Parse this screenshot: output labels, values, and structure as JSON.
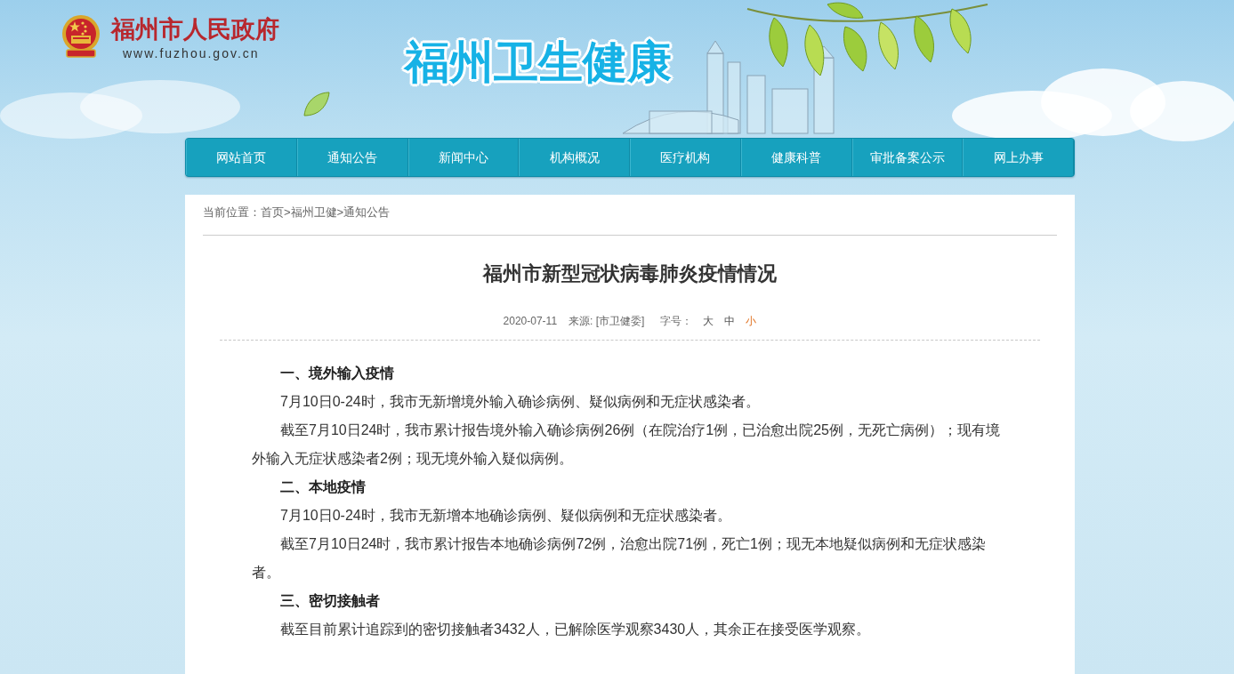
{
  "header": {
    "site_name": "福州市人民政府",
    "site_url": "www.fuzhou.gov.cn",
    "banner_title": "福州卫生健康"
  },
  "nav": [
    {
      "label": "网站首页"
    },
    {
      "label": "通知公告"
    },
    {
      "label": "新闻中心"
    },
    {
      "label": "机构概况"
    },
    {
      "label": "医疗机构"
    },
    {
      "label": "健康科普"
    },
    {
      "label": "审批备案公示"
    },
    {
      "label": "网上办事"
    }
  ],
  "breadcrumb": {
    "prefix": "当前位置：",
    "links": [
      {
        "label": "首页"
      },
      {
        "label": "福州卫健"
      },
      {
        "label": "通知公告"
      }
    ],
    "separators": [
      ">",
      ">"
    ]
  },
  "article": {
    "title": "福州市新型冠状病毒肺炎疫情情况",
    "date": "2020-07-11",
    "source": "来源: [市卫健委]",
    "font_size_label": "字号：",
    "font_sizes": [
      {
        "label": "大",
        "selected": false
      },
      {
        "label": "中",
        "selected": false
      },
      {
        "label": "小",
        "selected": true
      }
    ],
    "blocks": [
      {
        "kind": "heading",
        "text": "一、境外输入疫情"
      },
      {
        "kind": "paragraph",
        "text": "7月10日0-24时，我市无新增境外输入确诊病例、疑似病例和无症状感染者。"
      },
      {
        "kind": "paragraph",
        "text": "截至7月10日24时，我市累计报告境外输入确诊病例26例（在院治疗1例，已治愈出院25例，无死亡病例）；现有境外输入无症状感染者2例；现无境外输入疑似病例。"
      },
      {
        "kind": "heading",
        "text": "二、本地疫情"
      },
      {
        "kind": "paragraph",
        "text": "7月10日0-24时，我市无新增本地确诊病例、疑似病例和无症状感染者。"
      },
      {
        "kind": "paragraph",
        "text": "截至7月10日24时，我市累计报告本地确诊病例72例，治愈出院71例，死亡1例；现无本地疑似病例和无症状感染者。"
      },
      {
        "kind": "heading",
        "text": "三、密切接触者"
      },
      {
        "kind": "paragraph",
        "text": "截至目前累计追踪到的密切接触者3432人，已解除医学观察3430人，其余正在接受医学观察。"
      }
    ]
  }
}
